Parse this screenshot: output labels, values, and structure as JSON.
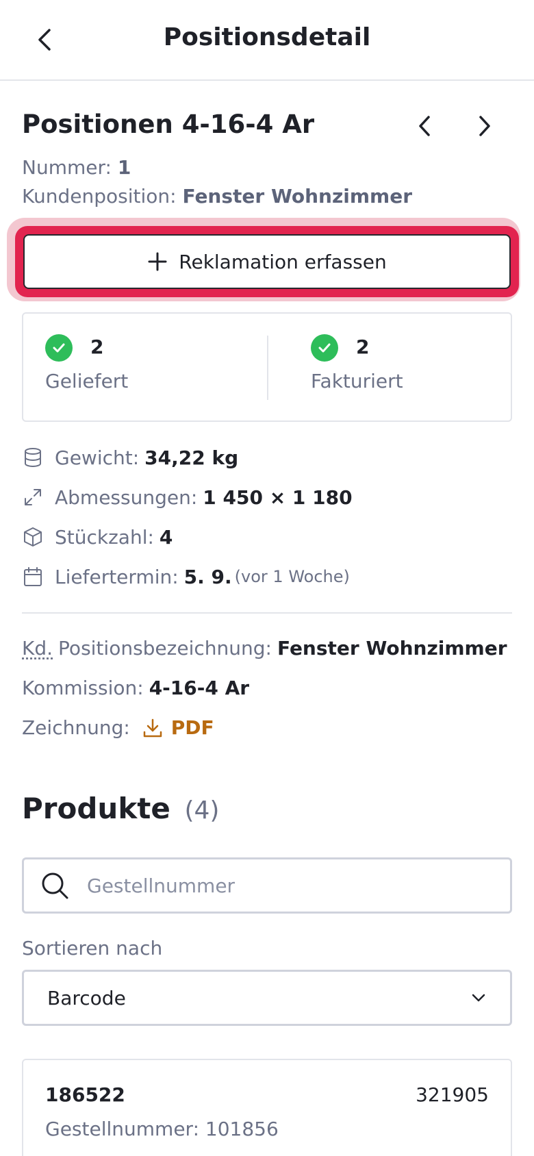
{
  "header": {
    "title": "Positionsdetail"
  },
  "position": {
    "title": "Positionen 4-16-4 Ar",
    "nummer_label": "Nummer:",
    "nummer_value": "1",
    "kundenposition_label": "Kundenposition:",
    "kundenposition_value": "Fenster Wohnzimmer"
  },
  "reklamation_button": {
    "label": "Reklamation erfassen"
  },
  "status": {
    "geliefert": {
      "count": "2",
      "label": "Geliefert"
    },
    "fakturiert": {
      "count": "2",
      "label": "Fakturiert"
    }
  },
  "specs": {
    "gewicht": {
      "label": "Gewicht:",
      "value": "34,22 kg"
    },
    "abmessungen": {
      "label": "Abmessungen:",
      "value": "1 450 × 1 180"
    },
    "stueckzahl": {
      "label": "Stückzahl:",
      "value": "4"
    },
    "liefertermin": {
      "label": "Liefertermin:",
      "value": "5. 9.",
      "relative": "(vor 1 Woche)"
    }
  },
  "details": {
    "kd_abbr": "Kd.",
    "positionsbezeichnung_label": "Positionsbezeichnung:",
    "positionsbezeichnung_value": "Fenster Wohnzimmer",
    "kommission_label": "Kommission:",
    "kommission_value": "4-16-4 Ar",
    "zeichnung_label": "Zeichnung:",
    "zeichnung_link": "PDF"
  },
  "produkte": {
    "title": "Produkte",
    "count": "(4)",
    "search_placeholder": "Gestellnummer",
    "search_value": "",
    "sort_label": "Sortieren nach",
    "sort_value": "Barcode",
    "items": [
      {
        "barcode": "186522",
        "number": "321905",
        "gestell_label": "Gestellnummer:",
        "gestell_value": "101856"
      }
    ]
  },
  "colors": {
    "accent_red": "#e2244f",
    "success_green": "#2ebd5a",
    "link_orange": "#b86a10"
  },
  "icons": [
    "chevron-left-icon",
    "chevron-right-icon",
    "plus-icon",
    "check-icon",
    "database-icon",
    "expand-icon",
    "box-icon",
    "calendar-icon",
    "download-icon",
    "search-icon",
    "chevron-down-icon"
  ]
}
